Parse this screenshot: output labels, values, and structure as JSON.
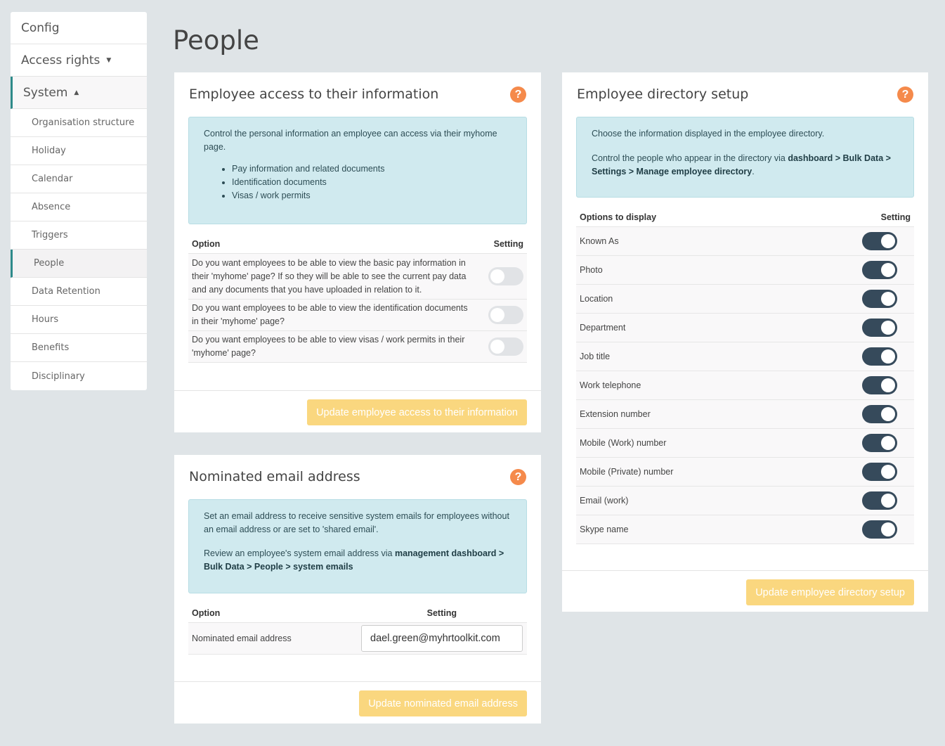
{
  "sidebar": {
    "config": "Config",
    "access_rights": "Access rights",
    "system": "System",
    "items": [
      "Organisation structure",
      "Holiday",
      "Calendar",
      "Absence",
      "Triggers",
      "People",
      "Data Retention",
      "Hours",
      "Benefits",
      "Disciplinary"
    ],
    "active": "People"
  },
  "page_title": "People",
  "colors": {
    "accent": "#2e8a8a",
    "help": "#f58a4b",
    "button": "#fad77f",
    "toggle_on": "#364a5b",
    "info_bg": "#d0eaef"
  },
  "access": {
    "title": "Employee access to their information",
    "info_text": "Control the personal information an employee can access via their myhome page.",
    "info_bullets": [
      "Pay information and related documents",
      "Identification documents",
      "Visas / work permits"
    ],
    "col_option": "Option",
    "col_setting": "Setting",
    "rows": [
      {
        "text": "Do you want employees to be able to view the basic pay information in their 'myhome' page? If so they will be able to see the current pay data and any documents that you have uploaded in relation to it.",
        "on": false
      },
      {
        "text": "Do you want employees to be able to view the identification documents in their 'myhome' page?",
        "on": false
      },
      {
        "text": "Do you want employees to be able to view visas / work permits in their 'myhome' page?",
        "on": false
      }
    ],
    "button": "Update employee access to their information"
  },
  "email": {
    "title": "Nominated email address",
    "info_p1": "Set an email address to receive sensitive system emails for employees without an email address or are set to 'shared email'.",
    "info_p2_pre": "Review an employee's system email address via ",
    "info_p2_bold": "management dashboard > Bulk Data > People > system emails",
    "col_option": "Option",
    "col_setting": "Setting",
    "row_label": "Nominated email address",
    "value": "dael.green@myhrtoolkit.com",
    "button": "Update nominated email address"
  },
  "directory": {
    "title": "Employee directory setup",
    "info_p1": "Choose the information displayed in the employee directory.",
    "info_p2_pre": "Control the people who appear in the directory via ",
    "info_p2_bold": "dashboard > Bulk Data > Settings > Manage employee directory",
    "info_p2_post": ".",
    "col_option": "Options to display",
    "col_setting": "Setting",
    "rows": [
      {
        "label": "Known As",
        "on": true
      },
      {
        "label": "Photo",
        "on": true
      },
      {
        "label": "Location",
        "on": true
      },
      {
        "label": "Department",
        "on": true
      },
      {
        "label": "Job title",
        "on": true
      },
      {
        "label": "Work telephone",
        "on": true
      },
      {
        "label": "Extension number",
        "on": true
      },
      {
        "label": "Mobile (Work) number",
        "on": true
      },
      {
        "label": "Mobile (Private) number",
        "on": true
      },
      {
        "label": "Email (work)",
        "on": true
      },
      {
        "label": "Skype name",
        "on": true
      }
    ],
    "button": "Update employee directory setup"
  }
}
